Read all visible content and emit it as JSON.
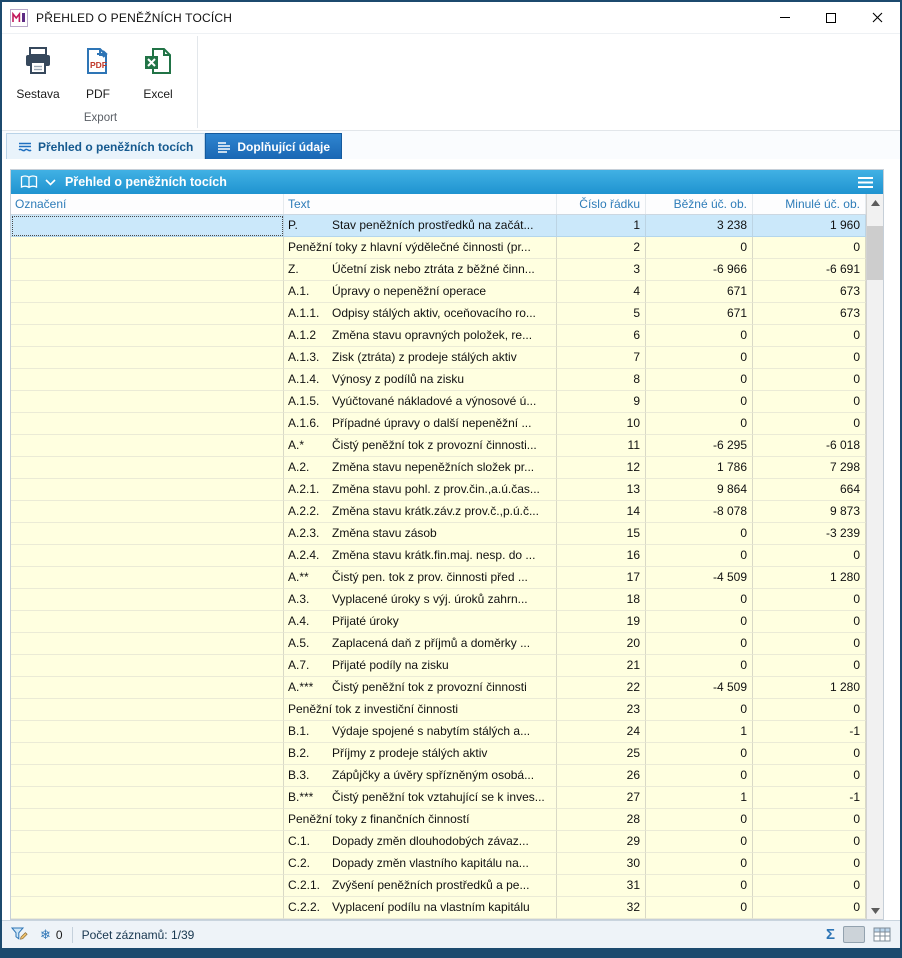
{
  "window": {
    "title": "PŘEHLED O PENĚŽNÍCH TOCÍCH"
  },
  "toolbar": {
    "group_label": "Export",
    "buttons": [
      {
        "label": "Sestava",
        "icon": "printer-icon"
      },
      {
        "label": "PDF",
        "icon": "pdf-export-icon"
      },
      {
        "label": "Excel",
        "icon": "excel-export-icon"
      }
    ]
  },
  "tabs": [
    {
      "label": "Přehled o peněžních tocích",
      "active": true,
      "icon": "cashflow-tab-icon"
    },
    {
      "label": "Doplňující údaje",
      "active": false,
      "icon": "details-tab-icon"
    }
  ],
  "panel": {
    "title": "Přehled o peněžních tocích",
    "icons": [
      "book-icon",
      "chevron-down-icon",
      "menu-icon"
    ]
  },
  "table": {
    "columns": [
      "Označení",
      "Text",
      "Číslo řádku",
      "Běžné úč. ob.",
      "Minulé úč. ob."
    ],
    "rows": [
      {
        "code": "P.",
        "text": "Stav peněžních prostředků na začát...",
        "line": "1",
        "current": "3 238",
        "previous": "1 960",
        "selected": true
      },
      {
        "code": "",
        "text": "Peněžní toky z hlavní výdělečné činnosti (pr...",
        "line": "2",
        "current": "0",
        "previous": "0"
      },
      {
        "code": "Z.",
        "text": "Účetní zisk nebo ztráta z běžné činn...",
        "line": "3",
        "current": "-6 966",
        "previous": "-6 691"
      },
      {
        "code": "A.1.",
        "text": "Úpravy o nepeněžní operace",
        "line": "4",
        "current": "671",
        "previous": "673"
      },
      {
        "code": "A.1.1.",
        "text": "Odpisy stálých aktiv, oceňovacího ro...",
        "line": "5",
        "current": "671",
        "previous": "673"
      },
      {
        "code": "A.1.2",
        "text": "Změna stavu opravných položek, re...",
        "line": "6",
        "current": "0",
        "previous": "0"
      },
      {
        "code": "A.1.3.",
        "text": "Zisk (ztráta) z prodeje stálých aktiv",
        "line": "7",
        "current": "0",
        "previous": "0"
      },
      {
        "code": "A.1.4.",
        "text": "Výnosy z podílů na zisku",
        "line": "8",
        "current": "0",
        "previous": "0"
      },
      {
        "code": "A.1.5.",
        "text": "Vyúčtované nákladové a výnosové ú...",
        "line": "9",
        "current": "0",
        "previous": "0"
      },
      {
        "code": "A.1.6.",
        "text": "Případné úpravy o další nepeněžní ...",
        "line": "10",
        "current": "0",
        "previous": "0"
      },
      {
        "code": "A.*",
        "text": "Čistý peněžní tok z provozní činnosti...",
        "line": "11",
        "current": "-6 295",
        "previous": "-6 018"
      },
      {
        "code": "A.2.",
        "text": "Změna stavu nepeněžních složek pr...",
        "line": "12",
        "current": "1 786",
        "previous": "7 298"
      },
      {
        "code": "A.2.1.",
        "text": "Změna stavu pohl. z prov.čin.,a.ú.čas...",
        "line": "13",
        "current": "9 864",
        "previous": "664"
      },
      {
        "code": "A.2.2.",
        "text": "Změna stavu krátk.záv.z prov.č.,p.ú.č...",
        "line": "14",
        "current": "-8 078",
        "previous": "9 873"
      },
      {
        "code": "A.2.3.",
        "text": "Změna stavu zásob",
        "line": "15",
        "current": "0",
        "previous": "-3 239"
      },
      {
        "code": "A.2.4.",
        "text": "Změna stavu krátk.fin.maj. nesp. do ...",
        "line": "16",
        "current": "0",
        "previous": "0"
      },
      {
        "code": "A.**",
        "text": "Čistý pen. tok z prov. činnosti před ...",
        "line": "17",
        "current": "-4 509",
        "previous": "1 280"
      },
      {
        "code": "A.3.",
        "text": "Vyplacené úroky s výj. úroků zahrn...",
        "line": "18",
        "current": "0",
        "previous": "0"
      },
      {
        "code": "A.4.",
        "text": "Přijaté úroky",
        "line": "19",
        "current": "0",
        "previous": "0"
      },
      {
        "code": "A.5.",
        "text": "Zaplacená daň z příjmů a doměrky ...",
        "line": "20",
        "current": "0",
        "previous": "0"
      },
      {
        "code": "A.7.",
        "text": "Přijaté podíly na zisku",
        "line": "21",
        "current": "0",
        "previous": "0"
      },
      {
        "code": "A.***",
        "text": "Čistý peněžní tok z provozní činnosti",
        "line": "22",
        "current": "-4 509",
        "previous": "1 280"
      },
      {
        "code": "",
        "text": "Peněžní tok z investiční činnosti",
        "line": "23",
        "current": "0",
        "previous": "0"
      },
      {
        "code": "B.1.",
        "text": "Výdaje spojené s nabytím stálých a...",
        "line": "24",
        "current": "1",
        "previous": "-1"
      },
      {
        "code": "B.2.",
        "text": "Příjmy z prodeje stálých aktiv",
        "line": "25",
        "current": "0",
        "previous": "0"
      },
      {
        "code": "B.3.",
        "text": "Zápůjčky a úvěry spřízněným osobá...",
        "line": "26",
        "current": "0",
        "previous": "0"
      },
      {
        "code": "B.***",
        "text": "Čistý peněžní tok vztahující se k inves...",
        "line": "27",
        "current": "1",
        "previous": "-1"
      },
      {
        "code": "",
        "text": "Peněžní toky z finančních činností",
        "line": "28",
        "current": "0",
        "previous": "0"
      },
      {
        "code": "C.1.",
        "text": "Dopady změn dlouhodobých závaz...",
        "line": "29",
        "current": "0",
        "previous": "0"
      },
      {
        "code": "C.2.",
        "text": "Dopady změn vlastního kapitálu na...",
        "line": "30",
        "current": "0",
        "previous": "0"
      },
      {
        "code": "C.2.1.",
        "text": "Zvýšení peněžních prostředků a pe...",
        "line": "31",
        "current": "0",
        "previous": "0"
      },
      {
        "code": "C.2.2.",
        "text": "Vyplacení podílu na vlastním kapitálu",
        "line": "32",
        "current": "0",
        "previous": "0"
      }
    ]
  },
  "statusbar": {
    "freeze_count": "0",
    "records_label": "Počet záznamů: 1/39",
    "icons": [
      "filter-icon",
      "snowflake-icon",
      "sigma-icon",
      "grid-export-icon"
    ]
  },
  "colors": {
    "window-border": "#1c4a6e",
    "panel-header-top": "#41b1e4",
    "panel-header-bottom": "#1f93d0",
    "row-bg": "#ffffe0",
    "selected-row-bg": "#cbe8fa",
    "header-text": "#2e7cb8",
    "tab-active-bg": "#e9f3fb",
    "accent": "#1f93d0"
  }
}
